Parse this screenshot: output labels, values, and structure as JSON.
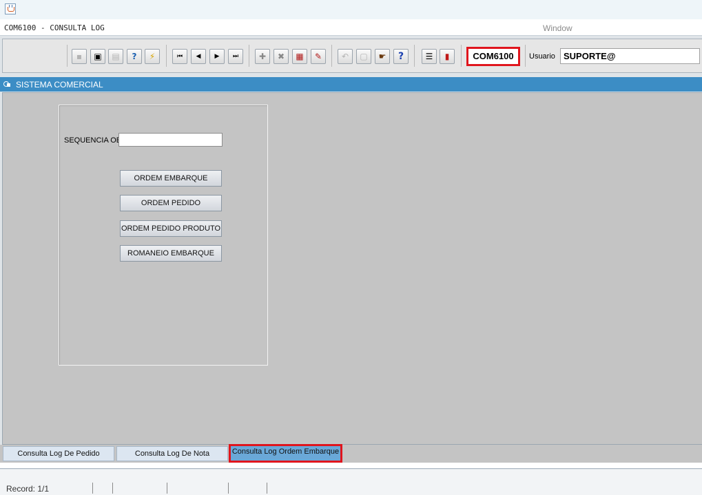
{
  "window": {
    "title": "COM6100 - CONSULTA LOG"
  },
  "menu": {
    "items": [
      "Window"
    ]
  },
  "toolbar": {
    "module_code": "COM6100",
    "user_label": "Usuario",
    "user_value": "SUPORTE@",
    "buttons": [
      {
        "icon": "save-icon",
        "glyph": "▪",
        "enabled": false
      },
      {
        "icon": "window-icon",
        "glyph": "▣",
        "enabled": true
      },
      {
        "icon": "print-icon",
        "glyph": "▤",
        "enabled": false
      },
      {
        "icon": "enter-query-icon",
        "glyph": "?",
        "enabled": true
      },
      {
        "icon": "execute-query-icon",
        "glyph": "⚡",
        "enabled": true
      },
      {
        "icon": "first-record-icon",
        "glyph": "⏮",
        "enabled": true
      },
      {
        "icon": "previous-record-icon",
        "glyph": "◀",
        "enabled": true
      },
      {
        "icon": "next-record-icon",
        "glyph": "▶",
        "enabled": true
      },
      {
        "icon": "last-record-icon",
        "glyph": "⏭",
        "enabled": true
      },
      {
        "icon": "insert-record-icon",
        "glyph": "✚",
        "enabled": true
      },
      {
        "icon": "delete-record-icon",
        "glyph": "✖",
        "enabled": true
      },
      {
        "icon": "list-values-icon",
        "glyph": "▦",
        "enabled": true
      },
      {
        "icon": "edit-icon",
        "glyph": "✎",
        "enabled": true
      },
      {
        "icon": "undo-icon",
        "glyph": "↶",
        "enabled": false
      },
      {
        "icon": "clipboard-icon",
        "glyph": "▢",
        "enabled": false
      },
      {
        "icon": "hand-pointer-icon",
        "glyph": "☛",
        "enabled": true
      },
      {
        "icon": "help-icon",
        "glyph": "?",
        "enabled": true
      },
      {
        "icon": "menu-icon",
        "glyph": "☰",
        "enabled": true
      },
      {
        "icon": "exit-door-icon",
        "glyph": "▮",
        "enabled": true
      }
    ]
  },
  "section": {
    "title": "SISTEMA COMERCIAL"
  },
  "form": {
    "sequence_label": "SEQUENCIA OE",
    "sequence_value": "",
    "buttons": [
      {
        "label": "ORDEM EMBARQUE"
      },
      {
        "label": "ORDEM PEDIDO"
      },
      {
        "label": "ORDEM PEDIDO PRODUTO"
      },
      {
        "label": "ROMANEIO EMBARQUE"
      }
    ]
  },
  "tabs": [
    {
      "label": "Consulta Log De Pedido",
      "active": false
    },
    {
      "label": "Consulta Log De Nota",
      "active": false
    },
    {
      "label": "Consulta Log Ordem Embarque",
      "active": true
    }
  ],
  "status": {
    "record": "Record: 1/1"
  },
  "colors": {
    "accent": "#3c8dc5",
    "highlight": "#e0151d",
    "workarea": "#c4c4c4"
  }
}
